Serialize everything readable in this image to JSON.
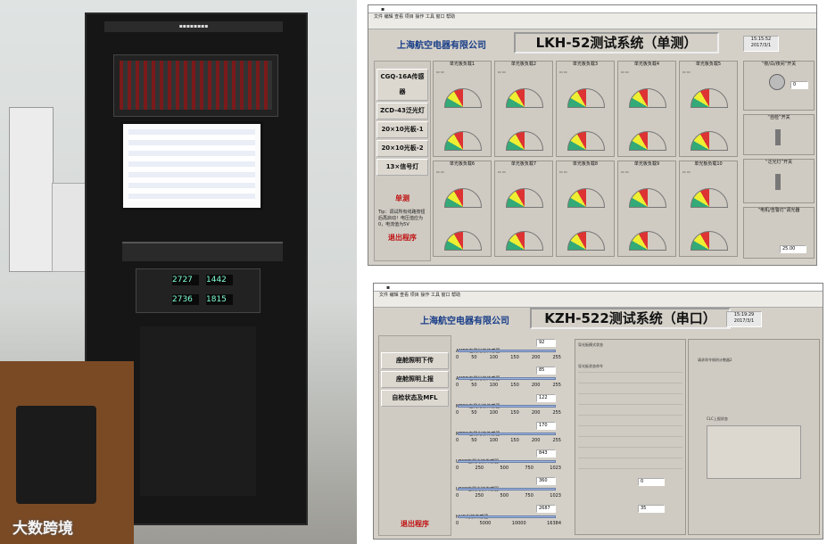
{
  "watermark": "大数跨境",
  "top_window": {
    "company": "上海航空电器有限公司",
    "title": "LKH-52测试系统（单测）",
    "time": "15:15:52",
    "date": "2017/3/1",
    "nav": [
      "CGQ-16A传感器",
      "ZCD-43泛光灯",
      "20×10光板-1",
      "20×10光板-2",
      "13×信号灯"
    ],
    "single_test": "单测",
    "tip": "Tip：调试所有线路按钮后再启动！电压值应为0，电流值为5V",
    "exit": "退出程序",
    "gauges": [
      "单光板负载1",
      "单光板负载2",
      "单光板负载3",
      "单光板负载4",
      "单光板负载5",
      "单光板负载6",
      "单光板负载7",
      "单光板负载8",
      "单光板负载9",
      "单光板负载10"
    ],
    "right": [
      "“夜/白/夜间”开关",
      "“自检”开关",
      "“泛光灯”开关",
      "“电机/告警灯”调光器"
    ],
    "knob_value": "0",
    "bottom_val": "25.00"
  },
  "bottom_window": {
    "company": "上海航空电器有限公司",
    "title": "KZH-522测试系统（串口）",
    "time": "15:19:29",
    "date": "2017/3/1",
    "nav": [
      "座舱照明下传",
      "座舱照明上报",
      "自检状态及MFL"
    ],
    "exit": "退出程序",
    "sliders": [
      {
        "label": "AMFD左侧光敏传感器",
        "value": "92"
      },
      {
        "label": "AMFD右侧光敏传感器",
        "value": "85"
      },
      {
        "label": "MFDS左侧光敏传感器",
        "value": "122"
      },
      {
        "label": "MFDS右侧光敏传感器",
        "value": "170"
      },
      {
        "label": "UFCP左侧光敏传感器",
        "value": "843"
      },
      {
        "label": "UFCP右侧光敏传感器",
        "value": "360"
      },
      {
        "label": "HUD光敏传感器",
        "value": "2687"
      }
    ],
    "scale_a": [
      "0",
      "50",
      "100",
      "150",
      "200",
      "255"
    ],
    "scale_b": [
      "0",
      "250",
      "500",
      "750",
      "1023"
    ],
    "scale_c": [
      "0",
      "5000",
      "10000",
      "16384"
    ],
    "mid_title": "导光板模式状态",
    "mid_sub": "导光板状态命令",
    "right_title": "请求命令帧的计数器2",
    "clc": "CLC上报状态",
    "val0": "0",
    "val35": "35"
  }
}
